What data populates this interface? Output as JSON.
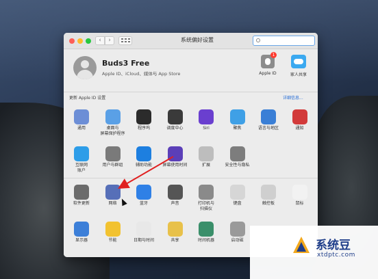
{
  "window": {
    "title": "系统偏好设置"
  },
  "account": {
    "name": "Buds3 Free",
    "subtitle": "Apple ID、iCloud、媒体与 App Store",
    "apple_id_label": "Apple ID",
    "apple_id_badge": "1",
    "family_label": "家人共享"
  },
  "update": {
    "text": "更新 Apple ID 设置",
    "link": "详细信息..."
  },
  "section1": [
    {
      "label": "通用",
      "icon": "general-icon",
      "color": "#6c8ed6"
    },
    {
      "label": "桌面与\n屏幕保护程序",
      "icon": "desktop-icon",
      "color": "#5aa0e6"
    },
    {
      "label": "程序坞",
      "icon": "dock-icon",
      "color": "#2b2b2b"
    },
    {
      "label": "调度中心",
      "icon": "mission-control-icon",
      "color": "#3a3a3a"
    },
    {
      "label": "Siri",
      "icon": "siri-icon",
      "color": "#6a3fcf"
    },
    {
      "label": "聚焦",
      "icon": "spotlight-icon",
      "color": "#3fa0e6"
    },
    {
      "label": "语言与地区",
      "icon": "language-icon",
      "color": "#3a7fd6"
    },
    {
      "label": "通知",
      "icon": "notifications-icon",
      "color": "#d23a3a"
    },
    {
      "label": "互联网\n账户",
      "icon": "internet-accounts-icon",
      "color": "#2d9de8"
    },
    {
      "label": "用户与群组",
      "icon": "users-icon",
      "color": "#7a7a7a"
    },
    {
      "label": "辅助功能",
      "icon": "accessibility-icon",
      "color": "#1d7fe0"
    },
    {
      "label": "屏幕使用时间",
      "icon": "screen-time-icon",
      "color": "#5b3fb8"
    },
    {
      "label": "扩展",
      "icon": "extensions-icon",
      "color": "#bdbdbd"
    },
    {
      "label": "安全性与隐私",
      "icon": "security-icon",
      "color": "#7d7d7d"
    }
  ],
  "section2": [
    {
      "label": "软件更新",
      "icon": "software-update-icon",
      "color": "#6b6b6b"
    },
    {
      "label": "网络",
      "icon": "network-icon",
      "color": "#566fb8"
    },
    {
      "label": "蓝牙",
      "icon": "bluetooth-icon",
      "color": "#2f80e6"
    },
    {
      "label": "声音",
      "icon": "sound-icon",
      "color": "#555555"
    },
    {
      "label": "打印机与\n扫描仪",
      "icon": "printers-icon",
      "color": "#8a8a8a"
    },
    {
      "label": "键盘",
      "icon": "keyboard-icon",
      "color": "#d6d6d6"
    },
    {
      "label": "触控板",
      "icon": "trackpad-icon",
      "color": "#cfcfcf"
    },
    {
      "label": "鼠标",
      "icon": "mouse-icon",
      "color": "#f2f2f2"
    },
    {
      "label": "显示器",
      "icon": "displays-icon",
      "color": "#3c7fd8"
    },
    {
      "label": "节能",
      "icon": "energy-saver-icon",
      "color": "#f2c230"
    },
    {
      "label": "日期与时间",
      "icon": "date-time-icon",
      "color": "#e8e8e8"
    },
    {
      "label": "共享",
      "icon": "sharing-icon",
      "color": "#e8c14a"
    },
    {
      "label": "时间机器",
      "icon": "time-machine-icon",
      "color": "#3a8f6a"
    },
    {
      "label": "启动磁",
      "icon": "startup-disk-icon",
      "color": "#9a9a9a"
    }
  ],
  "watermark": {
    "title": "系统豆",
    "url": "xtdptc.com"
  }
}
